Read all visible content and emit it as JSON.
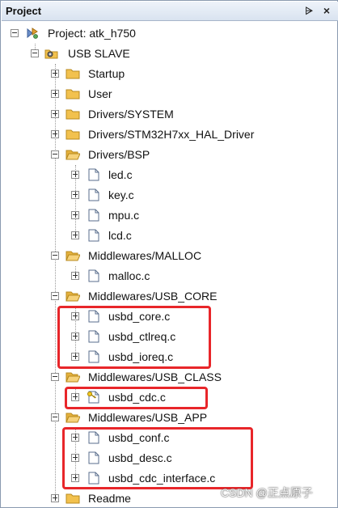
{
  "panel": {
    "title": "Project",
    "pin_glyph": "⩥",
    "close_glyph": "×"
  },
  "tree": {
    "project_label": "Project: atk_h750",
    "target_label": "USB SLAVE",
    "groups": {
      "startup": "Startup",
      "user": "User",
      "drivers_system": "Drivers/SYSTEM",
      "drivers_hal": "Drivers/STM32H7xx_HAL_Driver",
      "drivers_bsp": "Drivers/BSP",
      "mw_malloc": "Middlewares/MALLOC",
      "mw_usb_core": "Middlewares/USB_CORE",
      "mw_usb_class": "Middlewares/USB_CLASS",
      "mw_usb_app": "Middlewares/USB_APP",
      "readme": "Readme"
    },
    "files": {
      "led": "led.c",
      "key": "key.c",
      "mpu": "mpu.c",
      "lcd": "lcd.c",
      "malloc": "malloc.c",
      "usbd_core": "usbd_core.c",
      "usbd_ctlreq": "usbd_ctlreq.c",
      "usbd_ioreq": "usbd_ioreq.c",
      "usbd_cdc": "usbd_cdc.c",
      "usbd_conf": "usbd_conf.c",
      "usbd_desc": "usbd_desc.c",
      "usbd_cdc_interface": "usbd_cdc_interface.c"
    }
  },
  "watermark": "CSDN @正点原子",
  "colors": {
    "highlight_box": "#e8262a",
    "folder": "#f2c14e",
    "titlebar": "#dce6f2"
  }
}
